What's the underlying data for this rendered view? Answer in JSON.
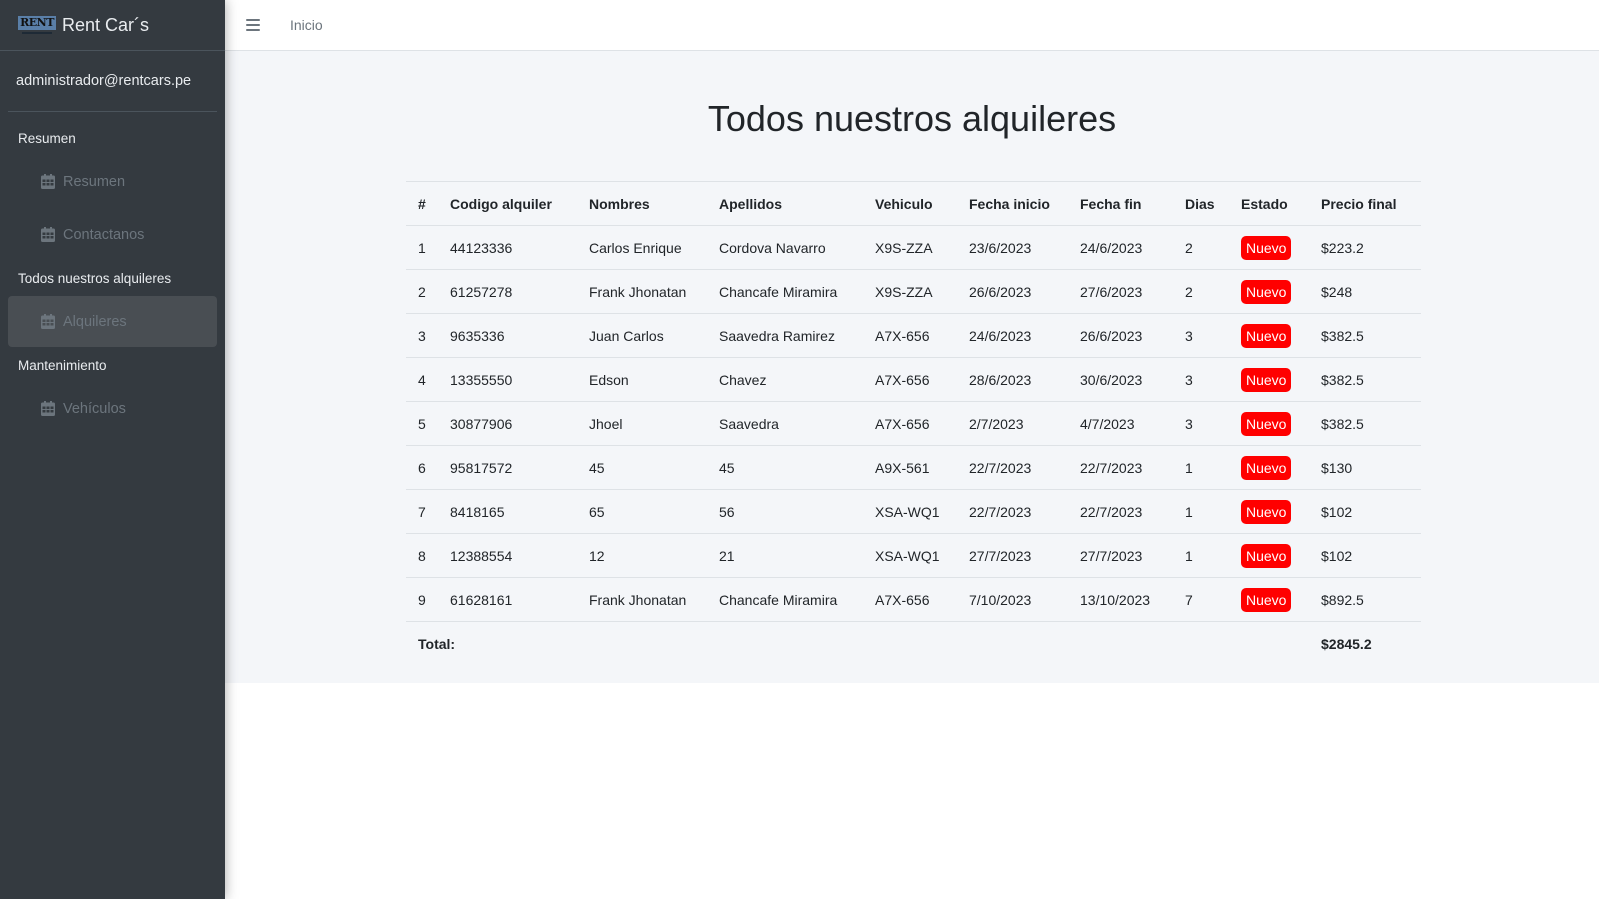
{
  "brand": {
    "name": "Rent Car´s",
    "logo_text": "RENT"
  },
  "user": {
    "email": "administrador@rentcars.pe"
  },
  "nav": [
    {
      "header": "Resumen",
      "items": [
        {
          "label": "Resumen",
          "icon": "calendar-icon"
        },
        {
          "label": "Contactanos",
          "icon": "calendar-icon"
        }
      ]
    },
    {
      "header": "Todos nuestros alquileres",
      "items": [
        {
          "label": "Alquileres",
          "icon": "calendar-icon",
          "active": true
        }
      ]
    },
    {
      "header": "Mantenimiento",
      "items": [
        {
          "label": "Vehículos",
          "icon": "calendar-icon"
        }
      ]
    }
  ],
  "topbar": {
    "menu_icon": "hamburger-icon",
    "home_link": "Inicio"
  },
  "page": {
    "title": "Todos nuestros alquileres"
  },
  "table": {
    "columns": [
      "#",
      "Codigo alquiler",
      "Nombres",
      "Apellidos",
      "Vehiculo",
      "Fecha inicio",
      "Fecha fin",
      "Dias",
      "Estado",
      "Precio final"
    ],
    "rows": [
      [
        "1",
        "44123336",
        "Carlos Enrique",
        "Cordova Navarro",
        "X9S-ZZA",
        "23/6/2023",
        "24/6/2023",
        "2",
        "Nuevo",
        "$223.2"
      ],
      [
        "2",
        "61257278",
        "Frank Jhonatan",
        "Chancafe Miramira",
        "X9S-ZZA",
        "26/6/2023",
        "27/6/2023",
        "2",
        "Nuevo",
        "$248"
      ],
      [
        "3",
        "9635336",
        "Juan Carlos",
        "Saavedra Ramirez",
        "A7X-656",
        "24/6/2023",
        "26/6/2023",
        "3",
        "Nuevo",
        "$382.5"
      ],
      [
        "4",
        "13355550",
        "Edson",
        "Chavez",
        "A7X-656",
        "28/6/2023",
        "30/6/2023",
        "3",
        "Nuevo",
        "$382.5"
      ],
      [
        "5",
        "30877906",
        "Jhoel",
        "Saavedra",
        "A7X-656",
        "2/7/2023",
        "4/7/2023",
        "3",
        "Nuevo",
        "$382.5"
      ],
      [
        "6",
        "95817572",
        "45",
        "45",
        "A9X-561",
        "22/7/2023",
        "22/7/2023",
        "1",
        "Nuevo",
        "$130"
      ],
      [
        "7",
        "8418165",
        "65",
        "56",
        "XSA-WQ1",
        "22/7/2023",
        "22/7/2023",
        "1",
        "Nuevo",
        "$102"
      ],
      [
        "8",
        "12388554",
        "12",
        "21",
        "XSA-WQ1",
        "27/7/2023",
        "27/7/2023",
        "1",
        "Nuevo",
        "$102"
      ],
      [
        "9",
        "61628161",
        "Frank Jhonatan",
        "Chancafe Miramira",
        "A7X-656",
        "7/10/2023",
        "13/10/2023",
        "7",
        "Nuevo",
        "$892.5"
      ]
    ],
    "total_label": "Total:",
    "total_value": "$2845.2"
  },
  "colors": {
    "sidebar": "#343a40",
    "content_bg": "#f4f6f9",
    "badge": "#ff0000"
  }
}
